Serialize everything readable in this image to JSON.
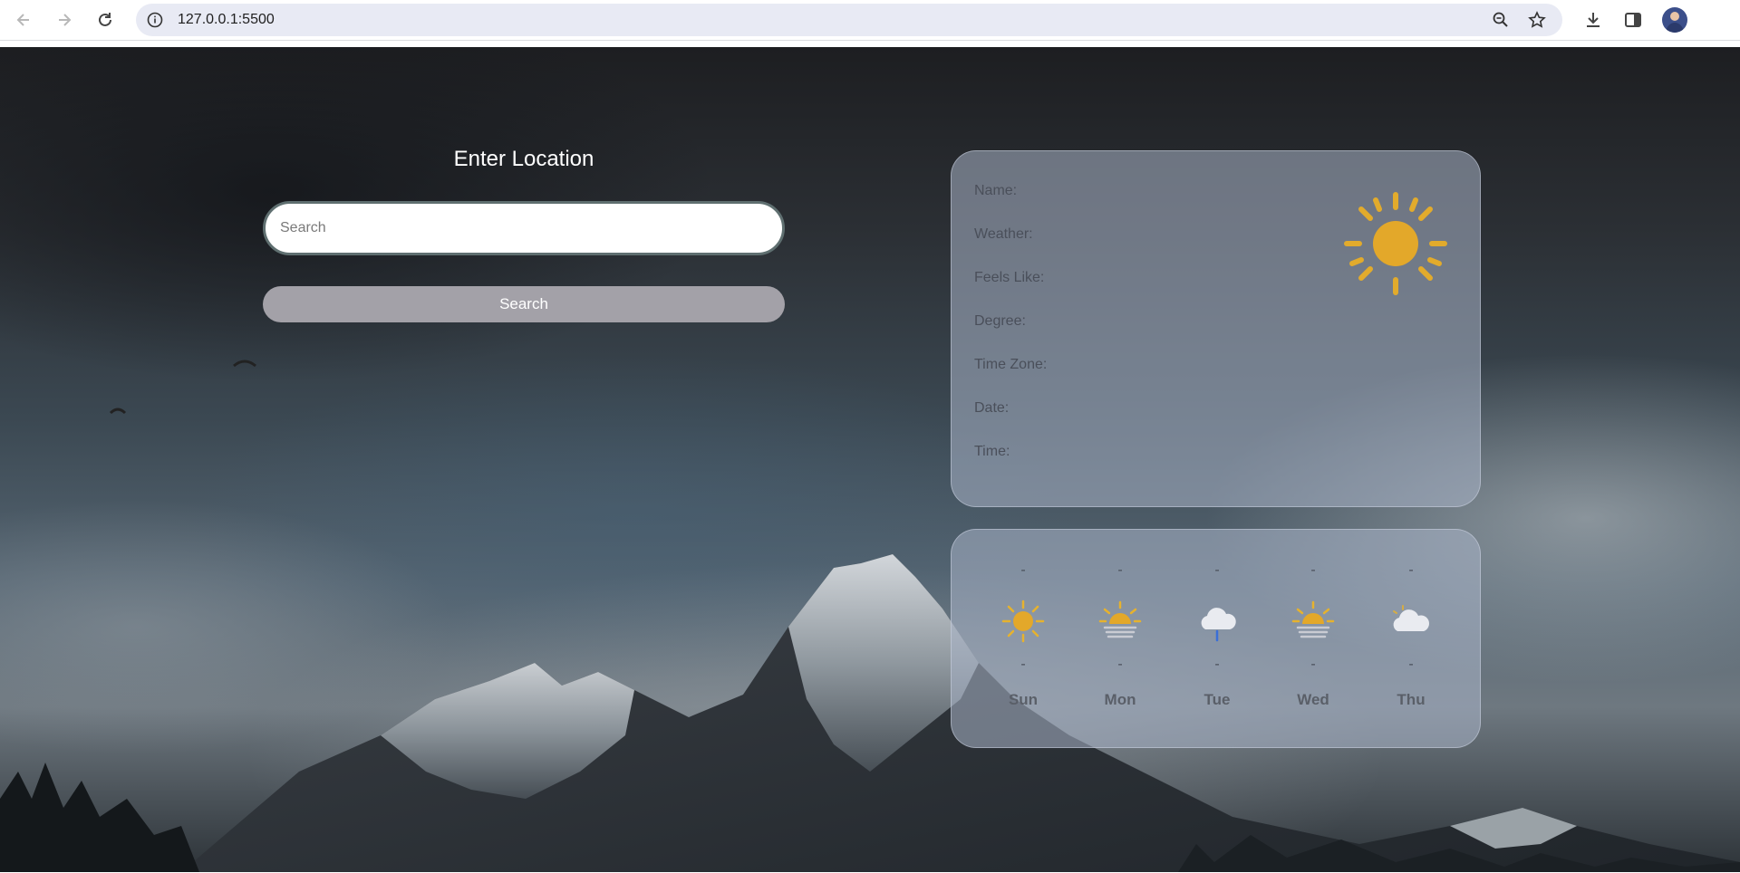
{
  "browser": {
    "url": "127.0.0.1:5500"
  },
  "search": {
    "title": "Enter Location",
    "placeholder": "Search",
    "button_label": "Search"
  },
  "current": {
    "fields": [
      {
        "label": "Name:"
      },
      {
        "label": "Weather:"
      },
      {
        "label": "Feels Like:"
      },
      {
        "label": "Degree:"
      },
      {
        "label": "Time Zone:"
      },
      {
        "label": "Date:"
      },
      {
        "label": "Time:"
      }
    ],
    "icon": "sun-icon"
  },
  "forecast": [
    {
      "top": "-",
      "mid": "-",
      "day": "Sun",
      "icon": "sun-icon"
    },
    {
      "top": "-",
      "mid": "-",
      "day": "Mon",
      "icon": "sun-haze-icon"
    },
    {
      "top": "-",
      "mid": "-",
      "day": "Tue",
      "icon": "cloud-rain-icon"
    },
    {
      "top": "-",
      "mid": "-",
      "day": "Wed",
      "icon": "sun-haze-icon"
    },
    {
      "top": "-",
      "mid": "-",
      "day": "Thu",
      "icon": "cloud-icon"
    }
  ],
  "colors": {
    "sun": "#e8b22a",
    "card": "#aab4c8",
    "button": "#a3a1a8"
  }
}
